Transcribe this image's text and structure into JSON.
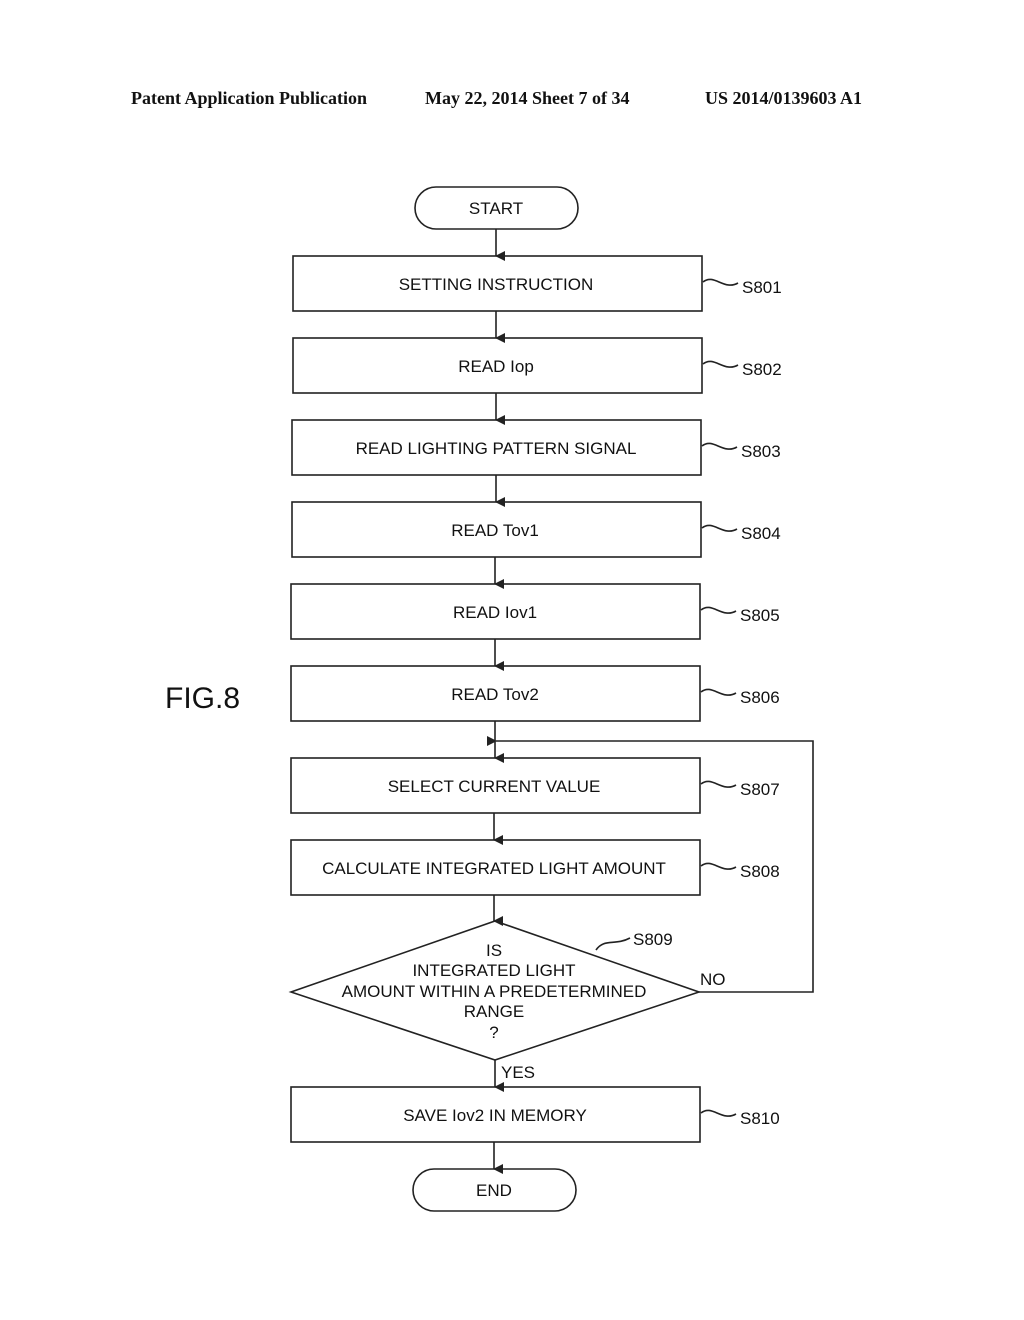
{
  "header": {
    "publication_type": "Patent Application Publication",
    "date_sheet": "May 22, 2014  Sheet 7 of 34",
    "patent_number": "US 2014/0139603 A1"
  },
  "figure_label": "FIG.8",
  "flowchart": {
    "start": "START",
    "end": "END",
    "steps": [
      {
        "id": "S801",
        "text": "SETTING INSTRUCTION"
      },
      {
        "id": "S802",
        "text": "READ Iop"
      },
      {
        "id": "S803",
        "text": "READ LIGHTING PATTERN SIGNAL"
      },
      {
        "id": "S804",
        "text": "READ Tov1"
      },
      {
        "id": "S805",
        "text": "READ Iov1"
      },
      {
        "id": "S806",
        "text": "READ Tov2"
      },
      {
        "id": "S807",
        "text": "SELECT CURRENT VALUE"
      },
      {
        "id": "S808",
        "text": "CALCULATE INTEGRATED LIGHT AMOUNT"
      }
    ],
    "decision": {
      "id": "S809",
      "lines": [
        "IS",
        "INTEGRATED LIGHT",
        "AMOUNT WITHIN A PREDETERMINED",
        "RANGE",
        "?"
      ],
      "yes_label": "YES",
      "no_label": "NO"
    },
    "final_step": {
      "id": "S810",
      "text": "SAVE Iov2 IN MEMORY"
    }
  }
}
